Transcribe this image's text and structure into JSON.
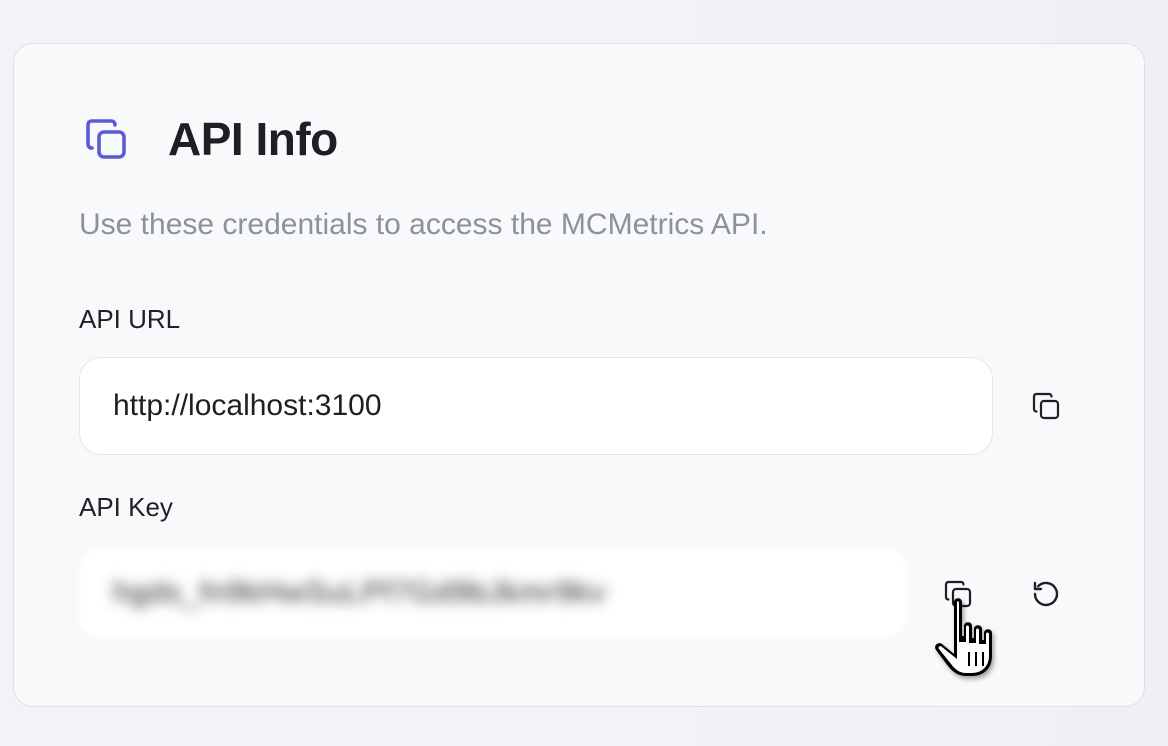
{
  "api_info": {
    "icon": "copy-icon",
    "title": "API Info",
    "description": "Use these credentials to access the MCMetrics API.",
    "url_field": {
      "label": "API URL",
      "value": "http://localhost:3100",
      "copy_icon": "copy-icon"
    },
    "key_field": {
      "label": "API Key",
      "value": "hgds_fn9kHwSuLPf7Gd9bJkmr9kv",
      "copy_icon": "copy-icon",
      "regenerate_icon": "refresh-icon"
    }
  },
  "colors": {
    "accent": "#5b5bd6",
    "card_background": "#f8f9fb",
    "page_background": "#f2f3f6"
  }
}
